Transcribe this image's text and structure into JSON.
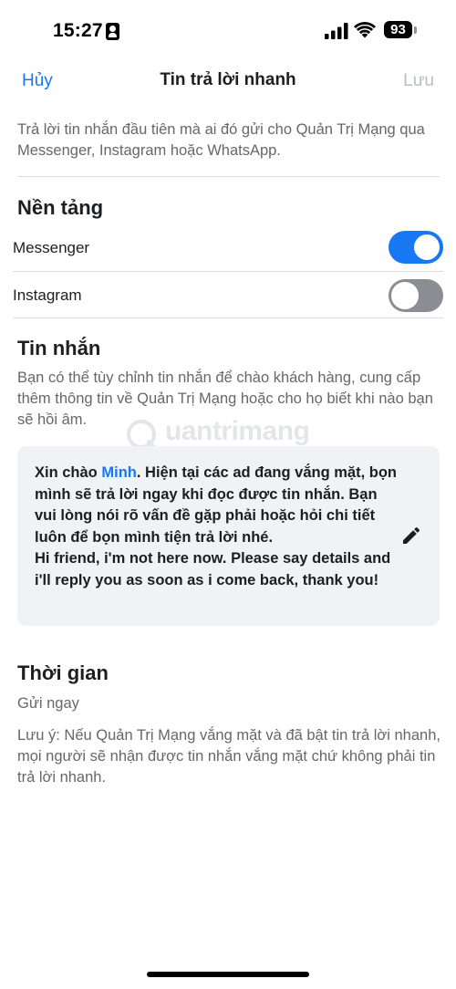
{
  "status_bar": {
    "time": "15:27",
    "battery": "93"
  },
  "nav": {
    "cancel_label": "Hủy",
    "title": "Tin trả lời nhanh",
    "save_label": "Lưu"
  },
  "intro_text": "Trả lời tin nhắn đầu tiên mà ai đó gửi cho Quản Trị Mạng qua Messenger, Instagram hoặc WhatsApp.",
  "platforms": {
    "title": "Nền tảng",
    "items": [
      {
        "label": "Messenger",
        "enabled": true
      },
      {
        "label": "Instagram",
        "enabled": false
      }
    ]
  },
  "message": {
    "title": "Tin nhắn",
    "description": "Bạn có thể tùy chỉnh tin nhắn để chào khách hàng, cung cấp thêm thông tin về Quản Trị Mạng hoặc cho họ biết khi nào bạn sẽ hồi âm.",
    "greeting": "Xin chào ",
    "name": "Minh",
    "body": ". Hiện tại các ad đang vắng mặt, bọn mình sẽ trả lời ngay khi đọc được tin nhắn. Bạn vui lòng nói rõ vấn đề gặp phải hoặc hỏi chi tiết luôn để bọn mình tiện trả lời nhé.",
    "english": "Hi friend, i'm not here now. Please say details and i'll reply you as soon as i come back, thank you!"
  },
  "watermark": {
    "text": "uantrimang"
  },
  "timing": {
    "title": "Thời gian",
    "value": "Gửi ngay",
    "note": "Lưu ý: Nếu Quản Trị Mạng vắng mặt và đã bật tin trả lời nhanh, mọi người sẽ nhận được tin nhắn vắng mặt chứ không phải tin trả lời nhanh."
  },
  "colors": {
    "accent": "#1877f2",
    "toggle_off": "#8a8d91",
    "card_bg": "#f0f2f5",
    "secondary_text": "#65676b",
    "disabled_text": "#b8bcc4"
  }
}
